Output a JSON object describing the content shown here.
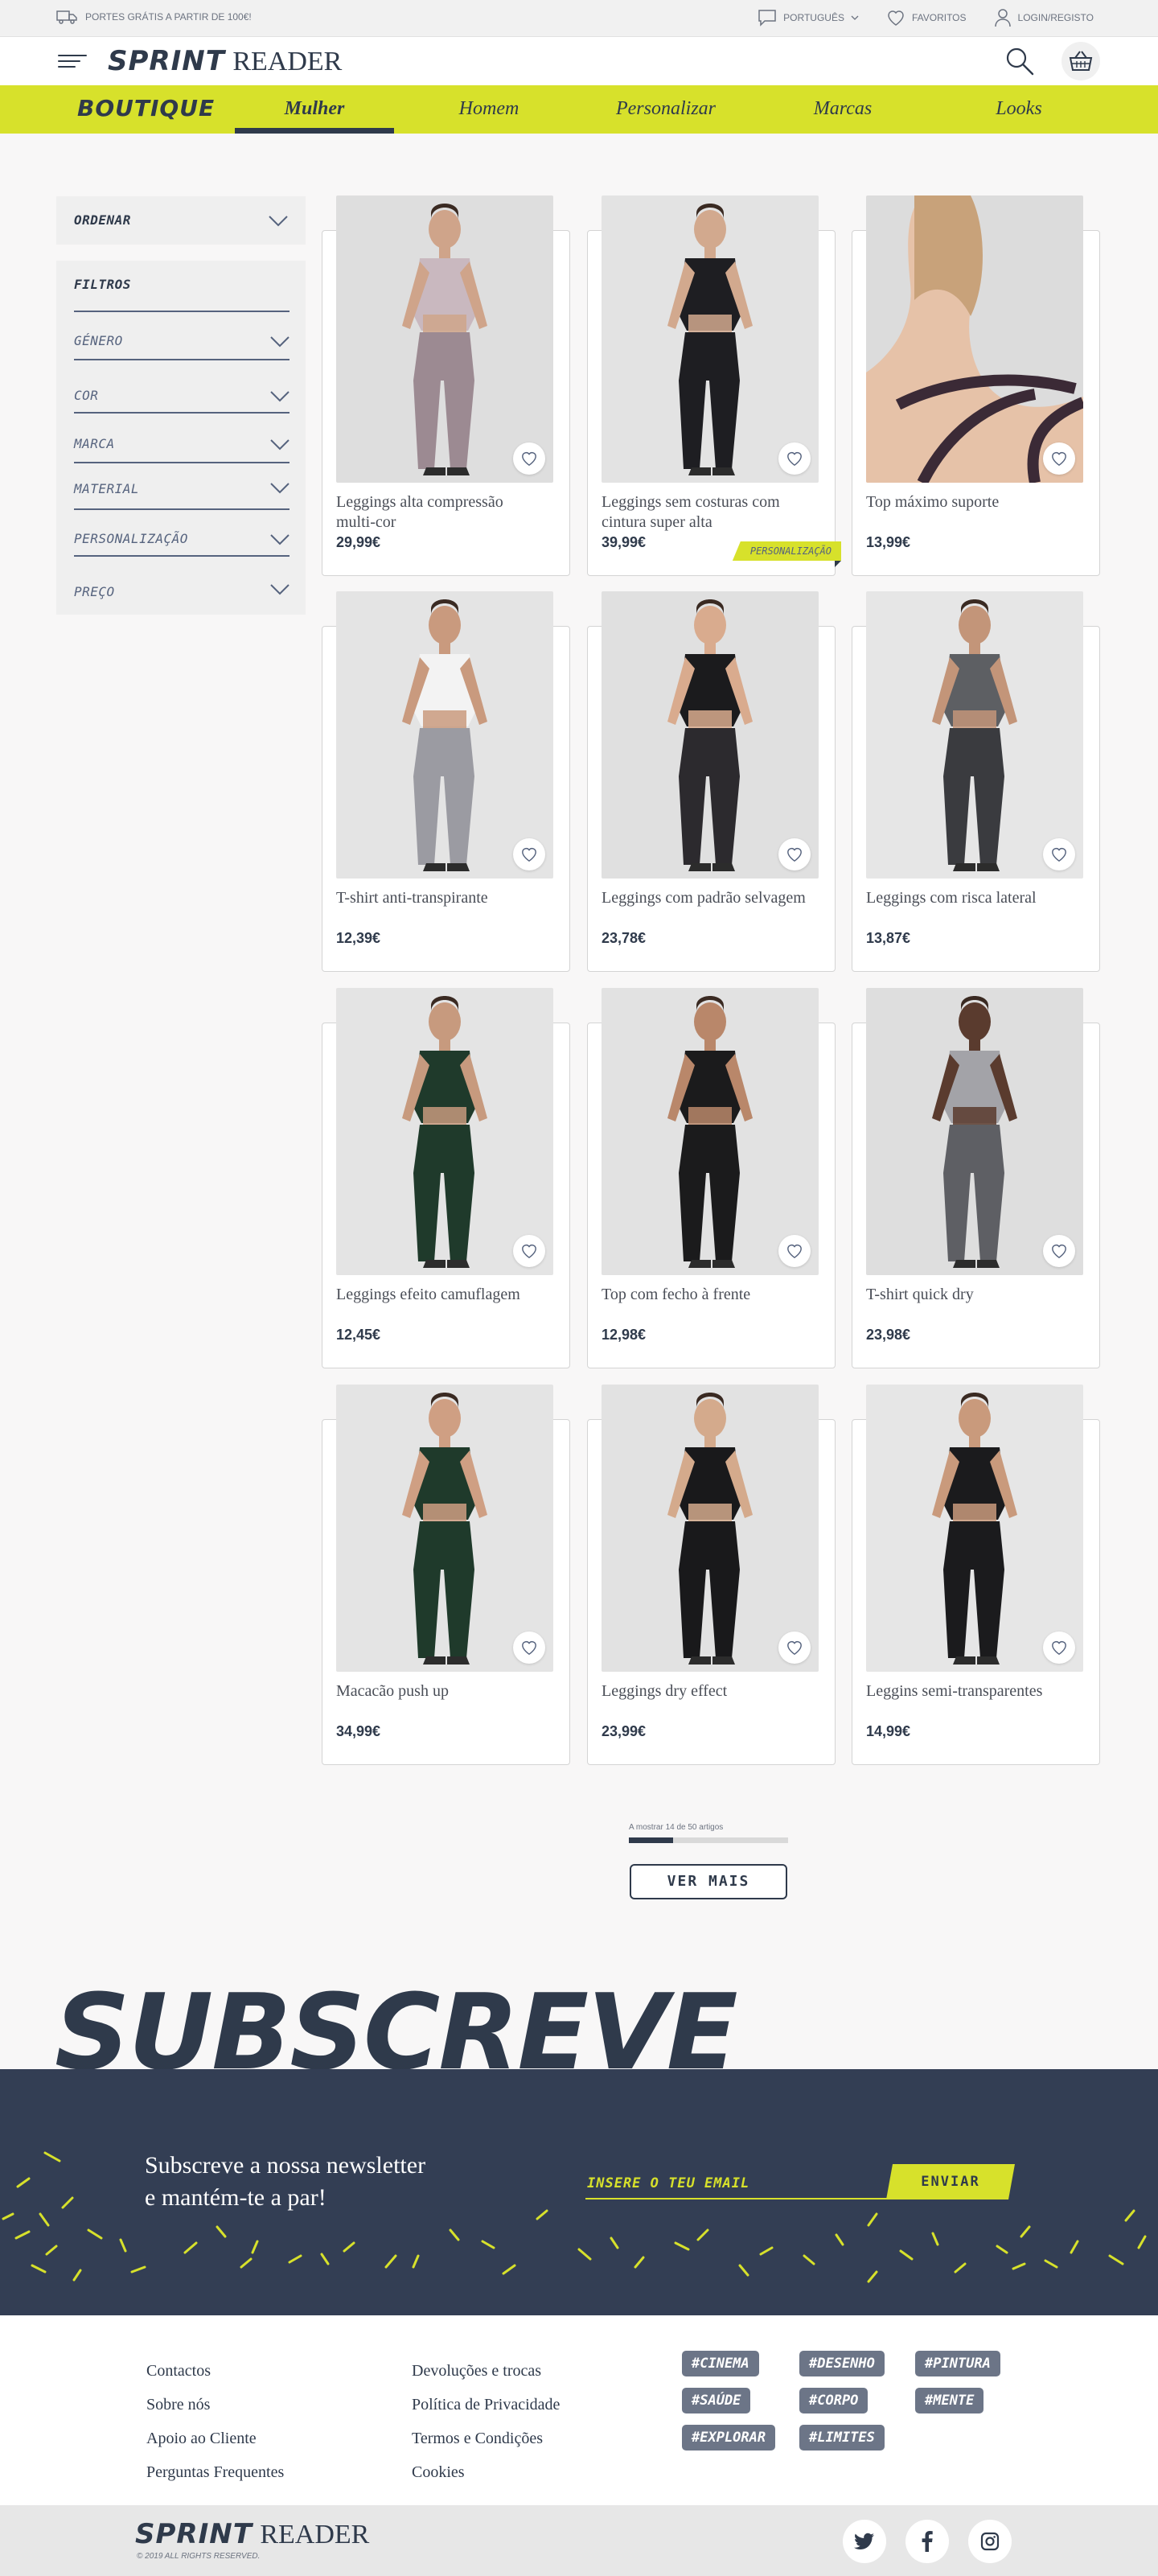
{
  "topbar": {
    "shipping": "PORTES GRÁTIS A PARTIR DE 100€!",
    "language": "PORTUGUÊS",
    "favorites": "FAVORITOS",
    "login": "LOGIN/REGISTO"
  },
  "header": {
    "logo_a": "SPRINT",
    "logo_b": "READER"
  },
  "nav": {
    "boutique": "BOUTIQUE",
    "tabs": [
      "Mulher",
      "Homem",
      "Personalizar",
      "Marcas",
      "Looks"
    ],
    "active": "Mulher"
  },
  "sidebar": {
    "sort": "ORDENAR",
    "filters_title": "FILTROS",
    "filters": [
      "GÉNERO",
      "COR",
      "MARCA",
      "MATERIAL",
      "PERSONALIZAÇÃO",
      "PREÇO"
    ]
  },
  "products": [
    {
      "name": "Leggings alta compressão multi-cor",
      "price": "29,99€",
      "badge": ""
    },
    {
      "name": "Leggings sem costuras com cintura super alta",
      "price": "39,99€",
      "badge": "PERSONALIZAÇÃO"
    },
    {
      "name": "Top máximo suporte",
      "price": "13,99€",
      "badge": ""
    },
    {
      "name": "T-shirt anti-transpirante",
      "price": "12,39€",
      "badge": ""
    },
    {
      "name": "Leggings com padrão selvagem",
      "price": "23,78€",
      "badge": ""
    },
    {
      "name": "Leggings com risca lateral",
      "price": "13,87€",
      "badge": ""
    },
    {
      "name": "Leggings efeito camuflagem",
      "price": "12,45€",
      "badge": ""
    },
    {
      "name": "Top com fecho à frente",
      "price": "12,98€",
      "badge": ""
    },
    {
      "name": "T-shirt quick dry",
      "price": "23,98€",
      "badge": ""
    },
    {
      "name": "Macacão push up",
      "price": "34,99€",
      "badge": ""
    },
    {
      "name": "Leggings dry effect",
      "price": "23,99€",
      "badge": ""
    },
    {
      "name": "Leggins semi-transparentes",
      "price": "14,99€",
      "badge": ""
    }
  ],
  "pagination": {
    "showing": "A mostrar 14 de 50 artigos",
    "progress": 0.28,
    "button": "VER MAIS"
  },
  "subscribe": {
    "title": "SUBSCREVE",
    "line1": "Subscreve a nossa newsletter",
    "line2": "e mantém-te a par!",
    "placeholder": "INSERE O TEU EMAIL",
    "button": "ENVIAR"
  },
  "footer": {
    "col1": [
      "Contactos",
      "Sobre nós",
      "Apoio ao Cliente",
      "Perguntas Frequentes"
    ],
    "col2": [
      "Devoluções e trocas",
      "Política de Privacidade",
      "Termos e Condições",
      "Cookies"
    ],
    "tags": [
      "#CINEMA",
      "#DESENHO",
      "#PINTURA",
      "#SAÚDE",
      "#CORPO",
      "#MENTE",
      "#EXPLORAR",
      "#LIMITES"
    ],
    "copyright": "© 2019 ALL RIGHTS RESERVED."
  },
  "colors": {
    "accent": "#d7e12b",
    "navy": "#333e54",
    "text": "#2f3a4b"
  },
  "icons": [
    "truck-icon",
    "speech-bubble-icon",
    "chevron-down-icon",
    "heart-icon",
    "user-icon",
    "menu-icon",
    "search-icon",
    "basket-icon",
    "twitter-icon",
    "facebook-icon",
    "instagram-icon"
  ]
}
